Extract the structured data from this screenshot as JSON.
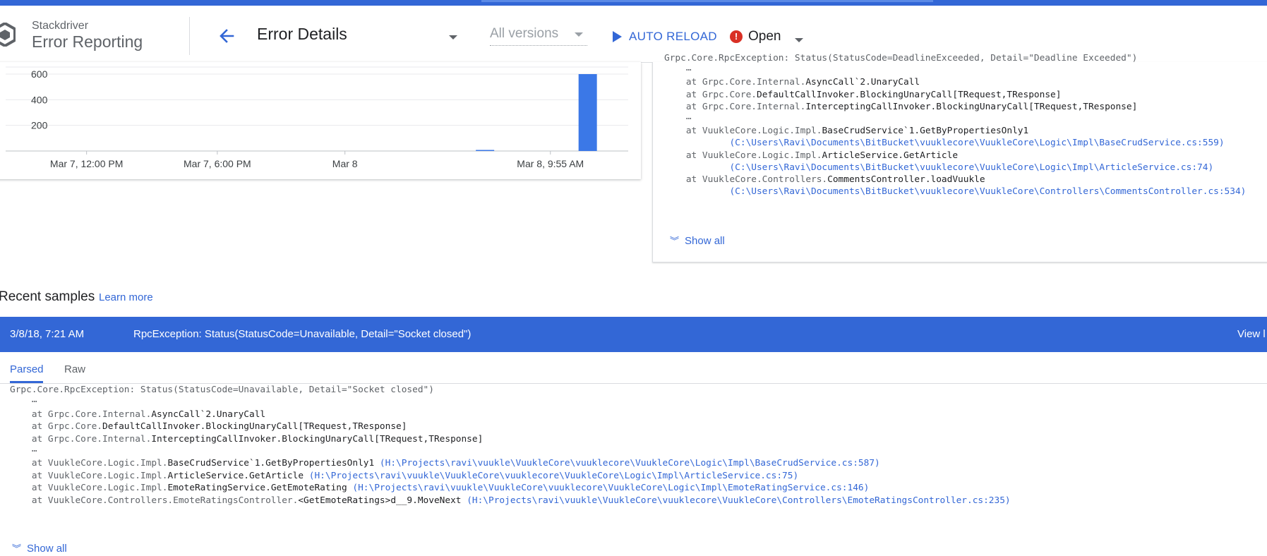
{
  "header": {
    "brand_small": "Stackdriver",
    "brand_big": "Error Reporting",
    "page_title": "Error Details",
    "versions_label": "All versions",
    "auto_reload_label": "AUTO RELOAD",
    "status_label": "Open",
    "status_icon_glyph": "!",
    "accent_color": "#3367d6"
  },
  "chart_data": {
    "type": "bar",
    "yticks": [
      "600",
      "400",
      "200"
    ],
    "xticks": [
      "Mar 7, 12:00 PM",
      "Mar 7, 6:00 PM",
      "Mar 8",
      "Mar 8, 9:55 AM"
    ],
    "ylim": [
      0,
      600
    ],
    "bars": [
      {
        "x_frac": 0.77,
        "value": 3
      },
      {
        "x_frac": 0.935,
        "value": 600
      }
    ],
    "grid": true
  },
  "stack_trace": {
    "lines": [
      [
        {
          "t": "Grpc.Core.RpcException: Status(StatusCode=DeadlineExceeded, Detail=\"Deadline Exceeded\")",
          "c": "gray"
        }
      ],
      [
        {
          "t": "    ⋯",
          "c": "gray"
        }
      ],
      [
        {
          "t": "    at Grpc.Core.Internal.",
          "c": "gray"
        },
        {
          "t": "AsyncCall`2.UnaryCall",
          "c": "dark"
        }
      ],
      [
        {
          "t": "    at Grpc.Core.",
          "c": "gray"
        },
        {
          "t": "DefaultCallInvoker.BlockingUnaryCall[TRequest,TResponse]",
          "c": "dark"
        }
      ],
      [
        {
          "t": "    at Grpc.Core.Internal.",
          "c": "gray"
        },
        {
          "t": "InterceptingCallInvoker.BlockingUnaryCall[TRequest,TResponse]",
          "c": "dark"
        }
      ],
      [
        {
          "t": "    ⋯",
          "c": "gray"
        }
      ],
      [
        {
          "t": "    at VuukleCore.Logic.Impl.",
          "c": "gray"
        },
        {
          "t": "BaseCrudService`1.GetByPropertiesOnly1",
          "c": "dark"
        }
      ],
      [
        {
          "t": "            (C:\\Users\\Ravi\\Documents\\BitBucket\\vuuklecore\\VuukleCore\\Logic\\Impl\\BaseCrudService.cs:559)",
          "c": "link"
        }
      ],
      [
        {
          "t": "    at VuukleCore.Logic.Impl.",
          "c": "gray"
        },
        {
          "t": "ArticleService.GetArticle",
          "c": "dark"
        }
      ],
      [
        {
          "t": "            (C:\\Users\\Ravi\\Documents\\BitBucket\\vuuklecore\\VuukleCore\\Logic\\Impl\\ArticleService.cs:74)",
          "c": "link"
        }
      ],
      [
        {
          "t": "    at VuukleCore.Controllers.",
          "c": "gray"
        },
        {
          "t": "CommentsController.loadVuukle",
          "c": "dark"
        }
      ],
      [
        {
          "t": "            (C:\\Users\\Ravi\\Documents\\BitBucket\\vuuklecore\\VuukleCore\\Controllers\\CommentsController.cs:534)",
          "c": "link"
        }
      ]
    ],
    "show_all_label": "Show all"
  },
  "recent_samples": {
    "title": "Recent samples",
    "learn_more": "Learn more",
    "sample": {
      "time": "3/8/18, 7:21 AM",
      "message": "RpcException: Status(StatusCode=Unavailable, Detail=\"Socket closed\")",
      "view_label": "View l"
    },
    "tabs": [
      "Parsed",
      "Raw"
    ],
    "lines": [
      [
        {
          "t": "Grpc.Core.RpcException: Status(StatusCode=Unavailable, Detail=\"Socket closed\")",
          "c": "gray"
        }
      ],
      [
        {
          "t": "    ⋯",
          "c": "gray"
        }
      ],
      [
        {
          "t": "    at Grpc.Core.Internal.",
          "c": "gray"
        },
        {
          "t": "AsyncCall`2.UnaryCall",
          "c": "dark"
        }
      ],
      [
        {
          "t": "    at Grpc.Core.",
          "c": "gray"
        },
        {
          "t": "DefaultCallInvoker.BlockingUnaryCall[TRequest,TResponse]",
          "c": "dark"
        }
      ],
      [
        {
          "t": "    at Grpc.Core.Internal.",
          "c": "gray"
        },
        {
          "t": "InterceptingCallInvoker.BlockingUnaryCall[TRequest,TResponse]",
          "c": "dark"
        }
      ],
      [
        {
          "t": "    ⋯",
          "c": "gray"
        }
      ],
      [
        {
          "t": "    at VuukleCore.Logic.Impl.",
          "c": "gray"
        },
        {
          "t": "BaseCrudService`1.GetByPropertiesOnly1",
          "c": "dark"
        },
        {
          "t": " (H:\\Projects\\ravi\\vuukle\\VuukleCore\\vuuklecore\\VuukleCore\\Logic\\Impl\\BaseCrudService.cs:587)",
          "c": "link"
        }
      ],
      [
        {
          "t": "    at VuukleCore.Logic.Impl.",
          "c": "gray"
        },
        {
          "t": "ArticleService.GetArticle",
          "c": "dark"
        },
        {
          "t": " (H:\\Projects\\ravi\\vuukle\\VuukleCore\\vuuklecore\\VuukleCore\\Logic\\Impl\\ArticleService.cs:75)",
          "c": "link"
        }
      ],
      [
        {
          "t": "    at VuukleCore.Logic.Impl.",
          "c": "gray"
        },
        {
          "t": "EmoteRatingService.GetEmoteRating",
          "c": "dark"
        },
        {
          "t": " (H:\\Projects\\ravi\\vuukle\\VuukleCore\\vuuklecore\\VuukleCore\\Logic\\Impl\\EmoteRatingService.cs:146)",
          "c": "link"
        }
      ],
      [
        {
          "t": "    at VuukleCore.Controllers.EmoteRatingsController.",
          "c": "gray"
        },
        {
          "t": "<GetEmoteRatings>d__9.MoveNext",
          "c": "dark"
        },
        {
          "t": " (H:\\Projects\\ravi\\vuukle\\VuukleCore\\vuuklecore\\VuukleCore\\Controllers\\EmoteRatingsController.cs:235)",
          "c": "link"
        }
      ]
    ],
    "show_all_label": "Show all"
  }
}
